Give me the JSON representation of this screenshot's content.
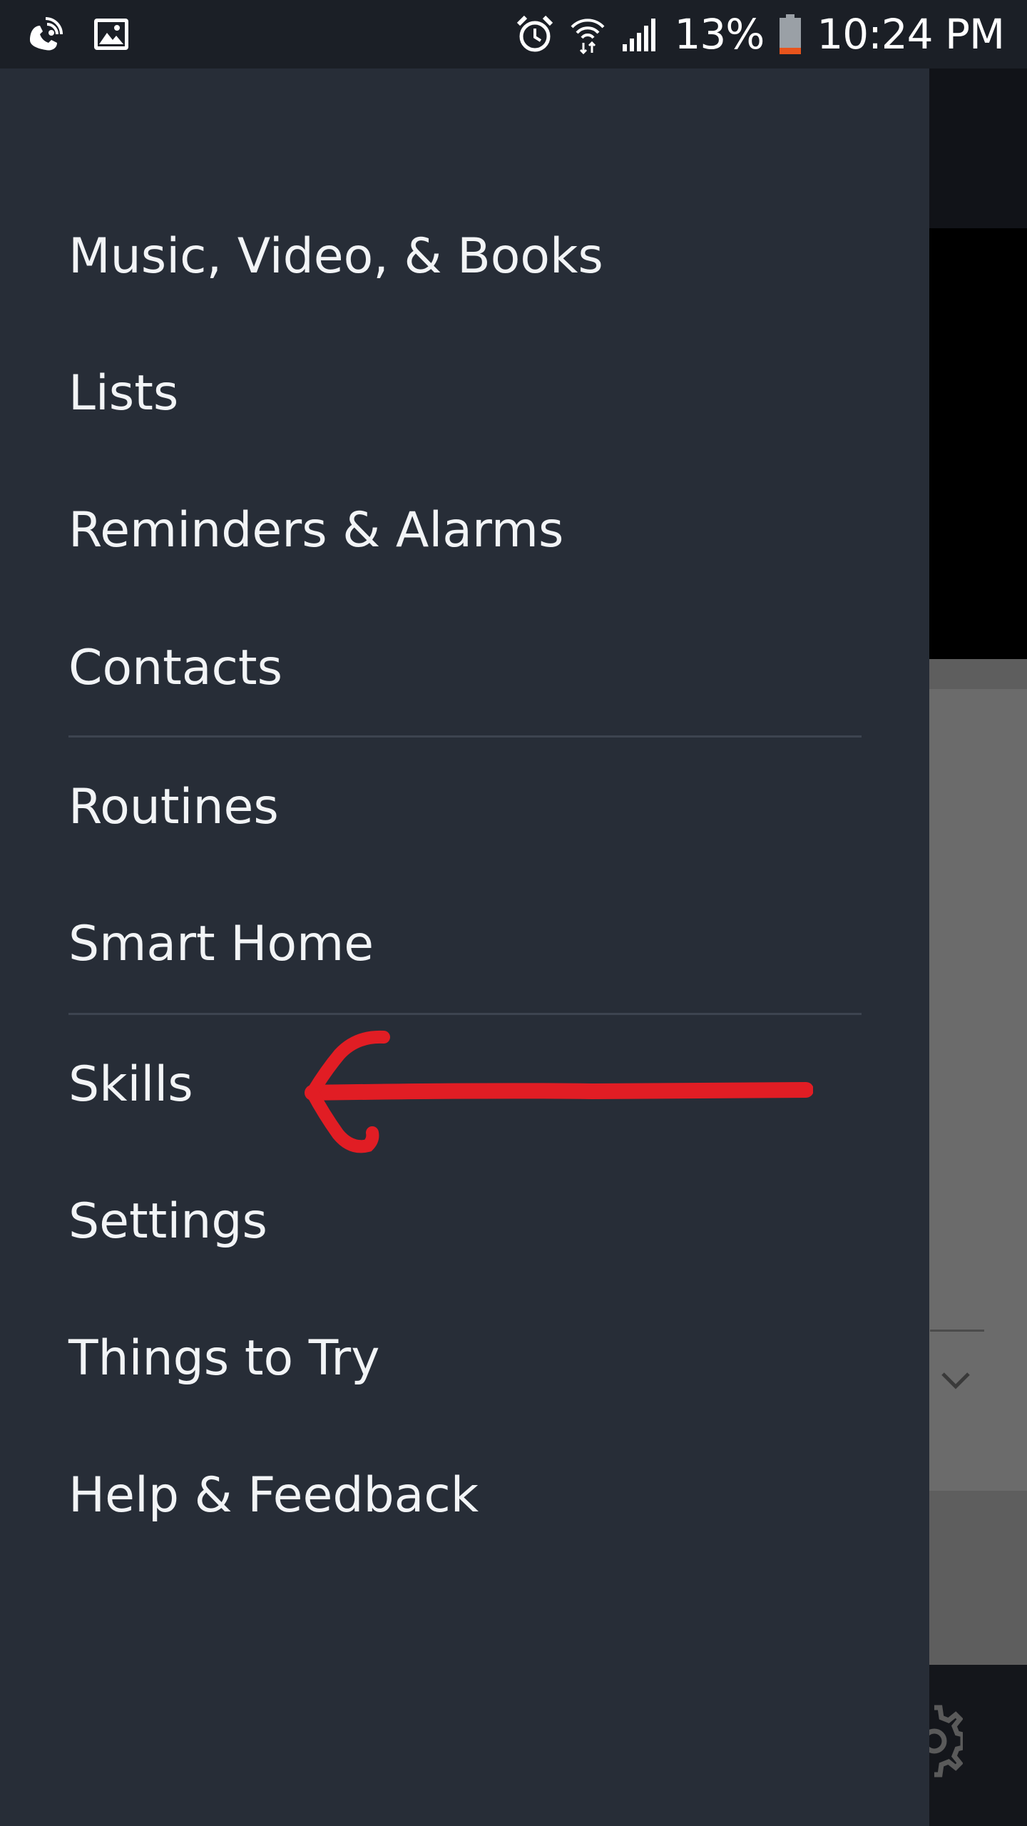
{
  "status_bar": {
    "battery_percent": "13%",
    "time": "10:24 PM",
    "icons": [
      "wifi-calling-icon",
      "gallery-icon",
      "alarm-icon",
      "wifi-icon",
      "signal-icon",
      "battery-icon"
    ]
  },
  "drawer": {
    "items": [
      {
        "label": "Music, Video, & Books"
      },
      {
        "label": "Lists"
      },
      {
        "label": "Reminders & Alarms"
      },
      {
        "label": "Contacts"
      },
      {
        "label": "Routines"
      },
      {
        "label": "Smart Home"
      },
      {
        "label": "Skills"
      },
      {
        "label": "Settings"
      },
      {
        "label": "Things to Try"
      },
      {
        "label": "Help & Feedback"
      }
    ]
  },
  "colors": {
    "drawer_bg": "#272d37",
    "status_bar_bg": "#1b1f26",
    "annotation_arrow": "#e11d24",
    "battery_low": "#e8541c"
  }
}
